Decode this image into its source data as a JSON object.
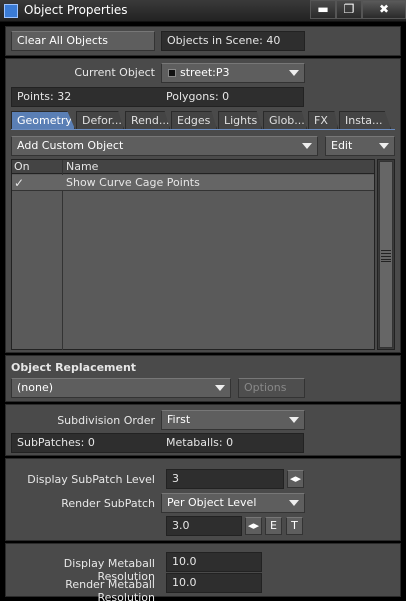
{
  "window": {
    "title": "Object Properties",
    "minimize": "▬",
    "maximize": "❐",
    "close": "✖"
  },
  "top": {
    "clear_all": "Clear All Objects",
    "objects_in_scene": "Objects in Scene: 40"
  },
  "current_object": {
    "label": "Current Object",
    "value": "street:P3",
    "points": "Points: 32",
    "polygons": "Polygons: 0"
  },
  "tabs": [
    "Geometry",
    "Defor...",
    "Rend...",
    "Edges",
    "Lights",
    "Glob...",
    "FX",
    "Insta..."
  ],
  "custom": {
    "add_label": "Add Custom Object",
    "edit_label": "Edit"
  },
  "table": {
    "col_on": "On",
    "col_name": "Name",
    "rows": [
      {
        "on": "✓",
        "name": "Show Curve Cage Points"
      }
    ]
  },
  "replacement": {
    "heading": "Object Replacement",
    "value": "(none)",
    "options": "Options"
  },
  "subdivision": {
    "order_label": "Subdivision Order",
    "order_value": "First",
    "subpatches": "SubPatches: 0",
    "metaballs": "Metaballs: 0"
  },
  "subpatch": {
    "display_label": "Display SubPatch Level",
    "display_value": "3",
    "render_label": "Render SubPatch",
    "render_value": "Per Object Level",
    "render_level": "3.0",
    "e_btn": "E",
    "t_btn": "T"
  },
  "metaball": {
    "display_label": "Display Metaball Resolution",
    "display_value": "10.0",
    "render_label": "Render Metaball Resolution",
    "render_value": "10.0"
  }
}
